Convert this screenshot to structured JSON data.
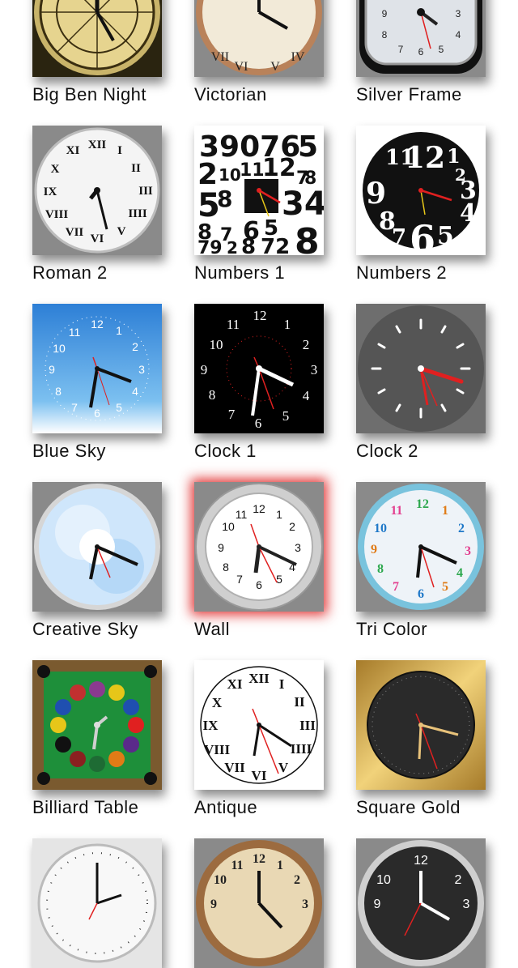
{
  "clocks": [
    {
      "name": "Big Ben Night",
      "selected": false
    },
    {
      "name": "Victorian",
      "selected": false
    },
    {
      "name": "Silver Frame",
      "selected": false
    },
    {
      "name": "Roman 2",
      "selected": false
    },
    {
      "name": "Numbers 1",
      "selected": false
    },
    {
      "name": "Numbers 2",
      "selected": false
    },
    {
      "name": "Blue Sky",
      "selected": false
    },
    {
      "name": "Clock 1",
      "selected": false
    },
    {
      "name": "Clock 2",
      "selected": false
    },
    {
      "name": "Creative Sky",
      "selected": false
    },
    {
      "name": "Wall",
      "selected": true
    },
    {
      "name": "Tri Color",
      "selected": false
    },
    {
      "name": "Billiard Table",
      "selected": false
    },
    {
      "name": "Antique",
      "selected": false
    },
    {
      "name": "Square Gold",
      "selected": false
    },
    {
      "name": "",
      "selected": false
    },
    {
      "name": "",
      "selected": false
    },
    {
      "name": "",
      "selected": false
    }
  ],
  "numerals": {
    "arabic": [
      "12",
      "1",
      "2",
      "3",
      "4",
      "5",
      "6",
      "7",
      "8",
      "9",
      "10",
      "11"
    ],
    "roman": [
      "XII",
      "I",
      "II",
      "III",
      "IV",
      "V",
      "VI",
      "VII",
      "VIII",
      "IX",
      "X",
      "XI"
    ],
    "numbers1": "39076 5 2 10 11 12 7 8 9 5 8 34 6 5 4 7 9 2 8 7 2 8",
    "numbers2": "10 11 12 1 2 3 9 4 8 7 6 5"
  },
  "colors": {
    "selected_glow": "#dc1414",
    "second_hand": "#e02020",
    "tri_color": [
      "#2ea84f",
      "#e07b16",
      "#1f78c8",
      "#e33f8f"
    ]
  }
}
